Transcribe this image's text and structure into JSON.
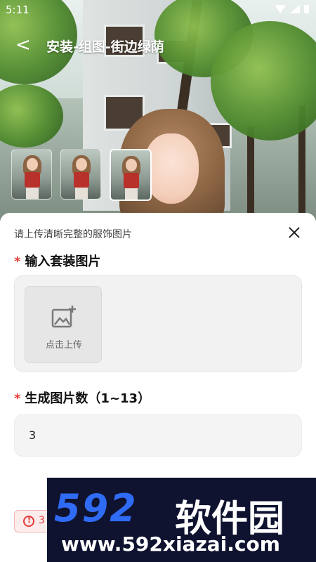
{
  "status_bar": {
    "time": "5:11"
  },
  "nav": {
    "title": "安装-组图-街边绿荫"
  },
  "thumbnails": [
    {
      "name": "look-1"
    },
    {
      "name": "look-2"
    },
    {
      "name": "look-3",
      "selected": true
    }
  ],
  "sheet": {
    "hint": "请上传清晰完整的服饰图片",
    "required_mark": "*",
    "outfit_label": "输入套装图片",
    "upload_label": "点击上传",
    "count_label": "生成图片数（1~13）",
    "count_value": "3",
    "warning_text": "3"
  },
  "watermark": {
    "brand_number": "592",
    "brand_text": "软件园",
    "url": "www.592xiazai.com"
  },
  "colors": {
    "required": "#e53935",
    "watermark_blue": "#2f6bf5",
    "watermark_bg": "#0f1330"
  }
}
